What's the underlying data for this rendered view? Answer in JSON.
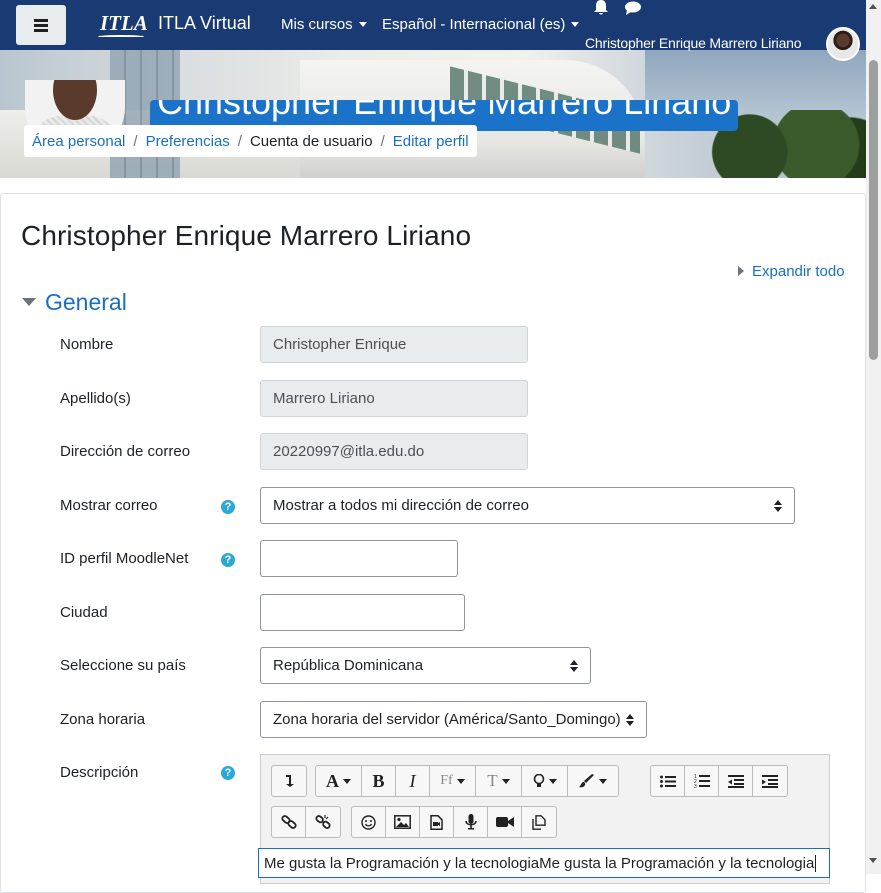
{
  "navbar": {
    "menu_icon": "hamburger-icon",
    "logo_text": "ITLA",
    "site_name": "ITLA Virtual",
    "my_courses": "Mis cursos",
    "language": "Español - Internacional (es)",
    "notifications_icon": "bell-icon",
    "messages_icon": "chat-icon",
    "user_name": "Christopher Enrique Marrero Liriano"
  },
  "header": {
    "title": "Christopher Enrique Marrero Liriano",
    "breadcrumb": [
      "Área personal",
      "Preferencias",
      "Cuenta de usuario",
      "Editar perfil"
    ]
  },
  "page": {
    "heading": "Christopher Enrique Marrero Liriano",
    "expand_all": "Expandir todo",
    "section": "General"
  },
  "form": {
    "nombre_label": "Nombre",
    "nombre_value": "Christopher Enrique",
    "apellido_label": "Apellido(s)",
    "apellido_value": "Marrero Liriano",
    "correo_label": "Dirección de correo",
    "correo_value": "20220997@itla.edu.do",
    "mostrar_correo_label": "Mostrar correo",
    "mostrar_correo_value": "Mostrar a todos mi dirección de correo",
    "moodlenet_label": "ID perfil MoodleNet",
    "moodlenet_value": "",
    "ciudad_label": "Ciudad",
    "ciudad_value": "",
    "pais_label": "Seleccione su país",
    "pais_value": "República Dominicana",
    "zona_label": "Zona horaria",
    "zona_value": "Zona horaria del servidor (América/Santo_Domingo)",
    "descripcion_label": "Descripción",
    "descripcion_value": "Me gusta la Programación y la tecnologiaMe gusta la Programación y la tecnologia",
    "help_icon": "question-circle-icon",
    "help_glyph": "?"
  },
  "editor_toolbar": {
    "font_glyph": "A",
    "bold_glyph": "B",
    "italic_glyph": "I",
    "style_glyph": "Ff",
    "text_glyph": "T",
    "icons": [
      "collapse-icon",
      "font-color-icon",
      "bold-icon",
      "italic-icon",
      "font-family-icon",
      "font-size-icon",
      "highlight-icon",
      "paint-brush-icon",
      "bullet-list-icon",
      "numbered-list-icon",
      "outdent-icon",
      "indent-icon",
      "link-icon",
      "unlink-icon",
      "emoji-icon",
      "image-icon",
      "media-icon",
      "record-audio-icon",
      "record-video-icon",
      "manage-files-icon"
    ]
  },
  "colors": {
    "navbar": "#1a3a73",
    "link": "#1a6fc4",
    "banner_title_bg": "#1a73c8",
    "help": "#2aa9d6"
  }
}
